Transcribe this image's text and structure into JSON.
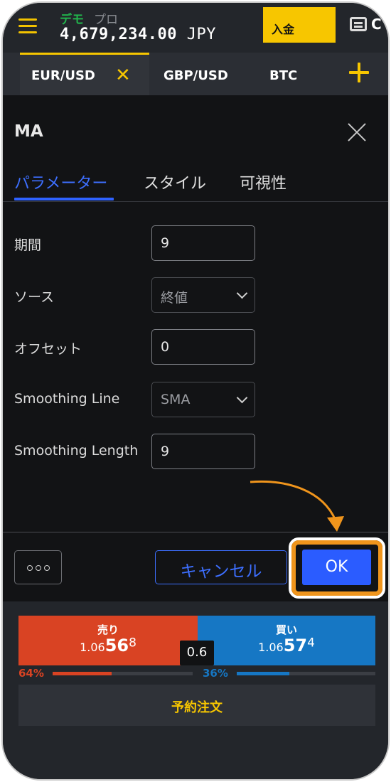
{
  "header": {
    "demo_label": "デモ",
    "pro_label": "プロ",
    "balance": "4,679,234.00",
    "currency": "JPY",
    "deposit_label": "入金",
    "wallet_label": "C"
  },
  "pairs": [
    {
      "label": "EUR/USD",
      "active": true
    },
    {
      "label": "GBP/USD",
      "active": false
    },
    {
      "label": "BTC",
      "active": false
    }
  ],
  "pair_close_glyph": "✕",
  "dialog": {
    "title": "MA",
    "tabs": [
      {
        "label": "パラメーター",
        "active": true
      },
      {
        "label": "スタイル",
        "active": false
      },
      {
        "label": "可視性",
        "active": false
      }
    ],
    "params": [
      {
        "label": "期間",
        "value": "9",
        "type": "input"
      },
      {
        "label": "ソース",
        "value": "終値",
        "type": "select"
      },
      {
        "label": "オフセット",
        "value": "0",
        "type": "input"
      },
      {
        "label": "Smoothing Line",
        "value": "SMA",
        "type": "select"
      },
      {
        "label": "Smoothing Length",
        "value": "9",
        "type": "input"
      }
    ],
    "cancel_label": "キャンセル",
    "ok_label": "OK"
  },
  "trade": {
    "sell_label": "売り",
    "sell_price_prefix": "1.06",
    "sell_price_main": "56",
    "sell_price_pip": "8",
    "buy_label": "買い",
    "buy_price_prefix": "1.06",
    "buy_price_main": "57",
    "buy_price_pip": "4",
    "spread": "0.6",
    "sell_pct": "64%",
    "buy_pct": "36%",
    "sell_ratio": 0.64,
    "buy_ratio": 0.36,
    "order_label": "予約注文"
  },
  "colors": {
    "accent_yellow": "#f7c600",
    "accent_blue": "#2b5cff",
    "sell_red": "#d94323",
    "buy_blue": "#1677c4",
    "highlight_orange": "#f0951c"
  },
  "icons": [
    "menu-icon",
    "wallet-icon",
    "close-icon",
    "plus-icon",
    "chevron-down-icon",
    "more-icon",
    "arrow-icon"
  ]
}
